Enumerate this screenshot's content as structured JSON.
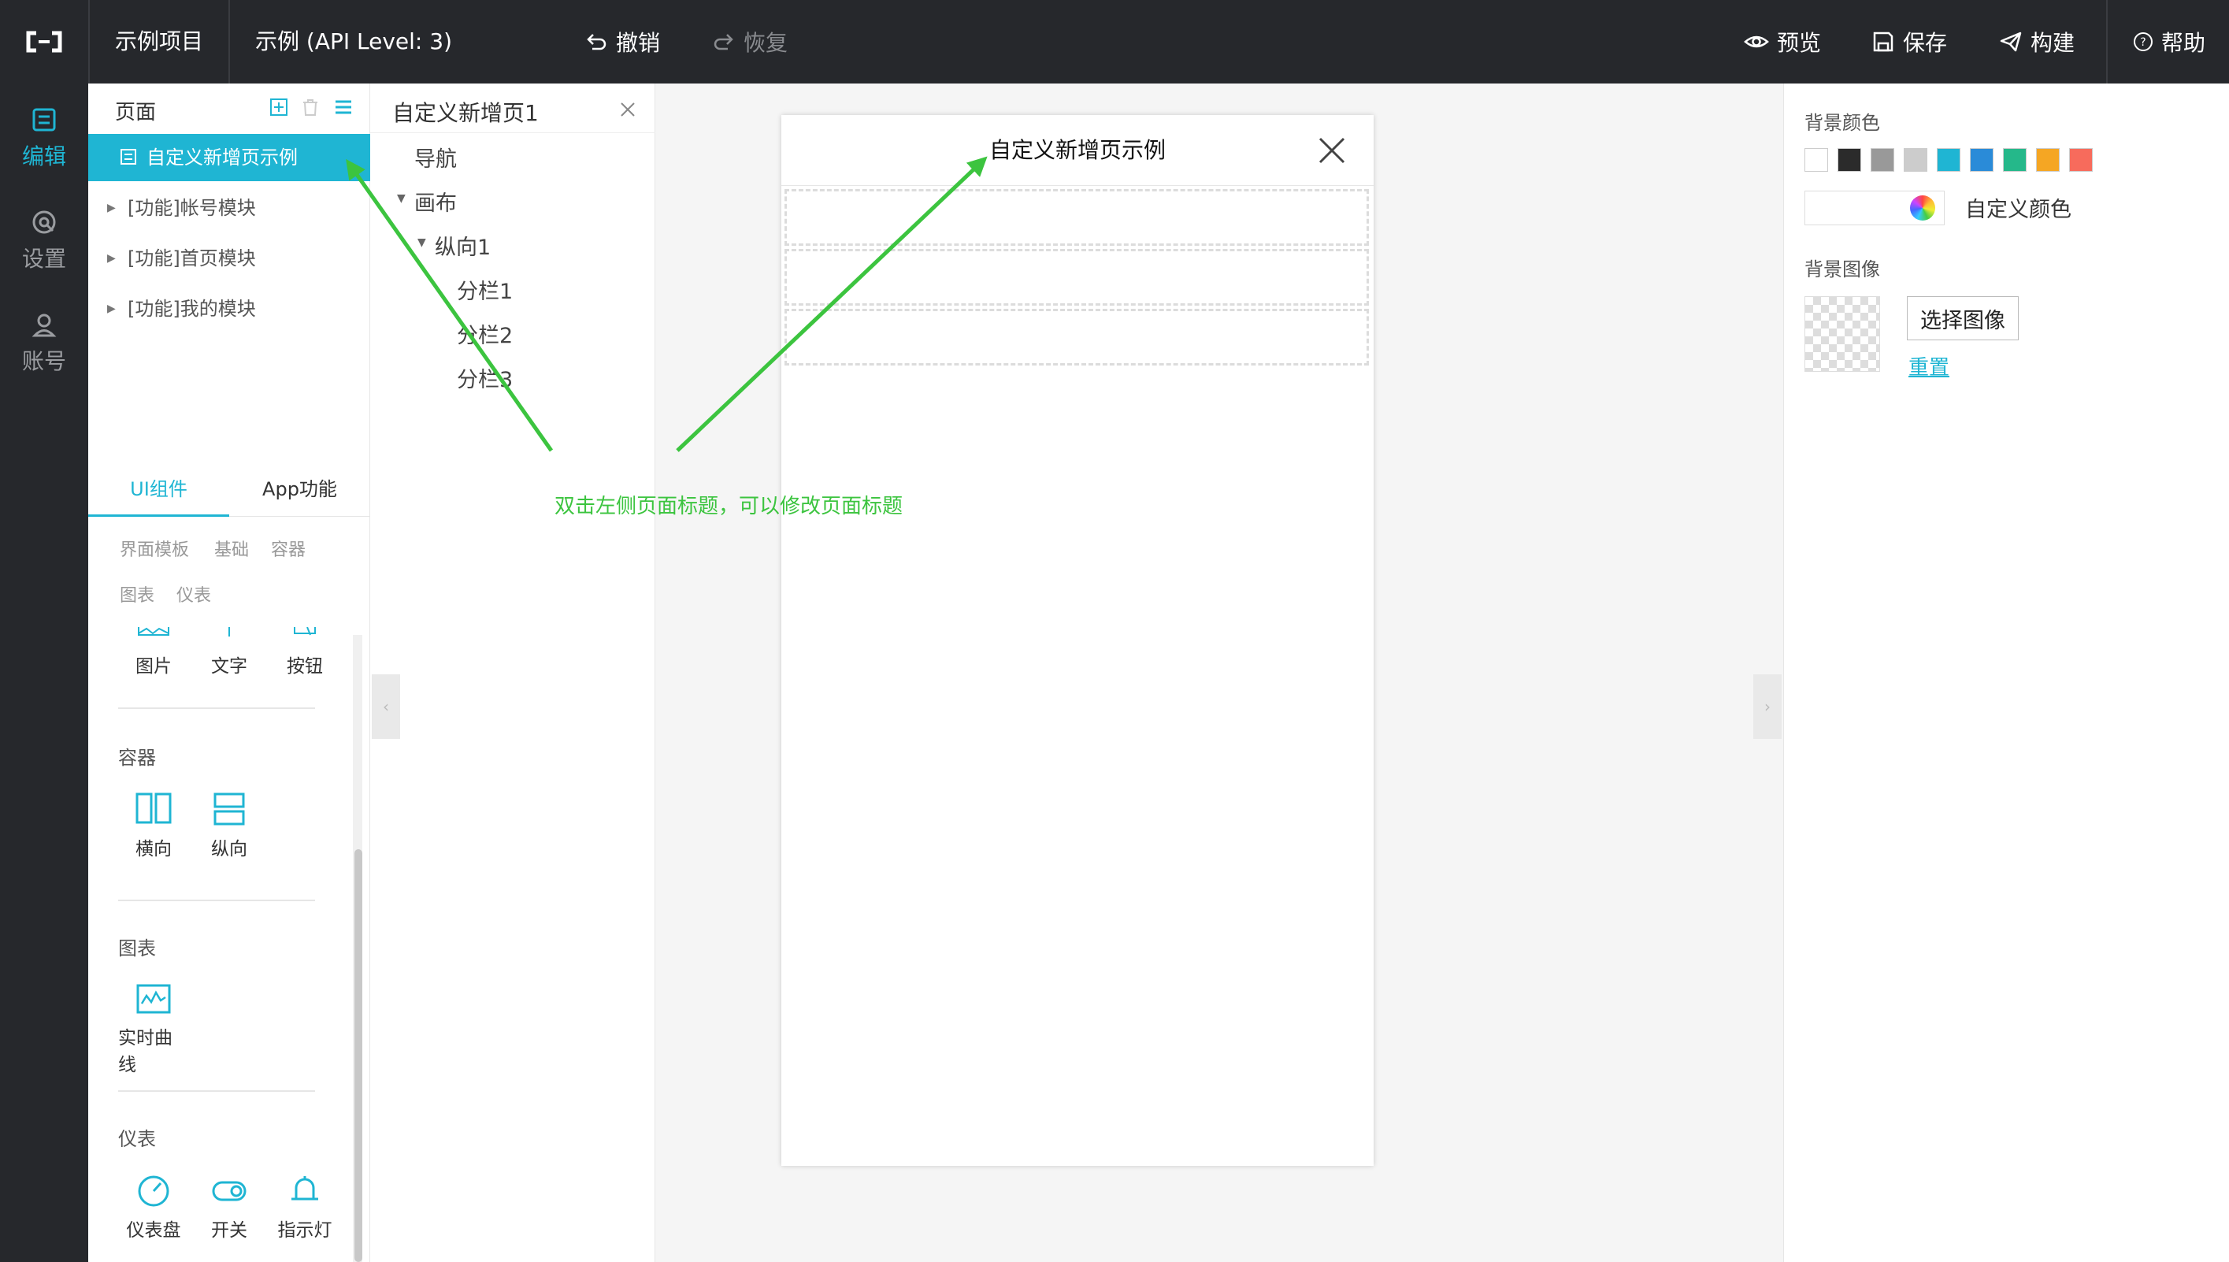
{
  "topbar": {
    "project": "示例项目",
    "app_title": "示例 (API Level: 3)",
    "undo": "撤销",
    "redo": "恢复",
    "preview": "预览",
    "save": "保存",
    "build": "构建",
    "help": "帮助"
  },
  "leftnav": {
    "edit": "编辑",
    "settings": "设置",
    "account": "账号"
  },
  "pages": {
    "title": "页面",
    "items": [
      "自定义新增页示例",
      "[功能]帐号模块",
      "[功能]首页模块",
      "[功能]我的模块"
    ]
  },
  "components": {
    "tabs": [
      "UI组件",
      "App功能"
    ],
    "categories": [
      "界面模板",
      "基础",
      "容器",
      "图表",
      "仪表"
    ],
    "basic_items": [
      "图片",
      "文字",
      "按钮"
    ],
    "container_title": "容器",
    "container_items": [
      "横向",
      "纵向"
    ],
    "chart_title": "图表",
    "chart_items": [
      "实时曲线"
    ],
    "gauge_title": "仪表",
    "gauge_items": [
      "仪表盘",
      "开关",
      "指示灯"
    ]
  },
  "tree": {
    "title": "自定义新增页1",
    "nodes": [
      "导航",
      "画布",
      "纵向1",
      "分栏1",
      "分栏2",
      "分栏3"
    ]
  },
  "canvas": {
    "page_title": "自定义新增页示例"
  },
  "props": {
    "bg_color_label": "背景颜色",
    "swatches": [
      "#ffffff",
      "#2b2b2b",
      "#999999",
      "#cccccc",
      "#1fb5d3",
      "#2a8bd8",
      "#25b88a",
      "#f5a623",
      "#f76b5c"
    ],
    "custom_color": "自定义颜色",
    "bg_image_label": "背景图像",
    "choose_image": "选择图像",
    "reset": "重置"
  },
  "annotation": {
    "text": "双击左侧页面标题，可以修改页面标题",
    "color": "#3cc43f"
  },
  "colors": {
    "accent": "#1fb5d3",
    "topbar": "#26282c"
  }
}
